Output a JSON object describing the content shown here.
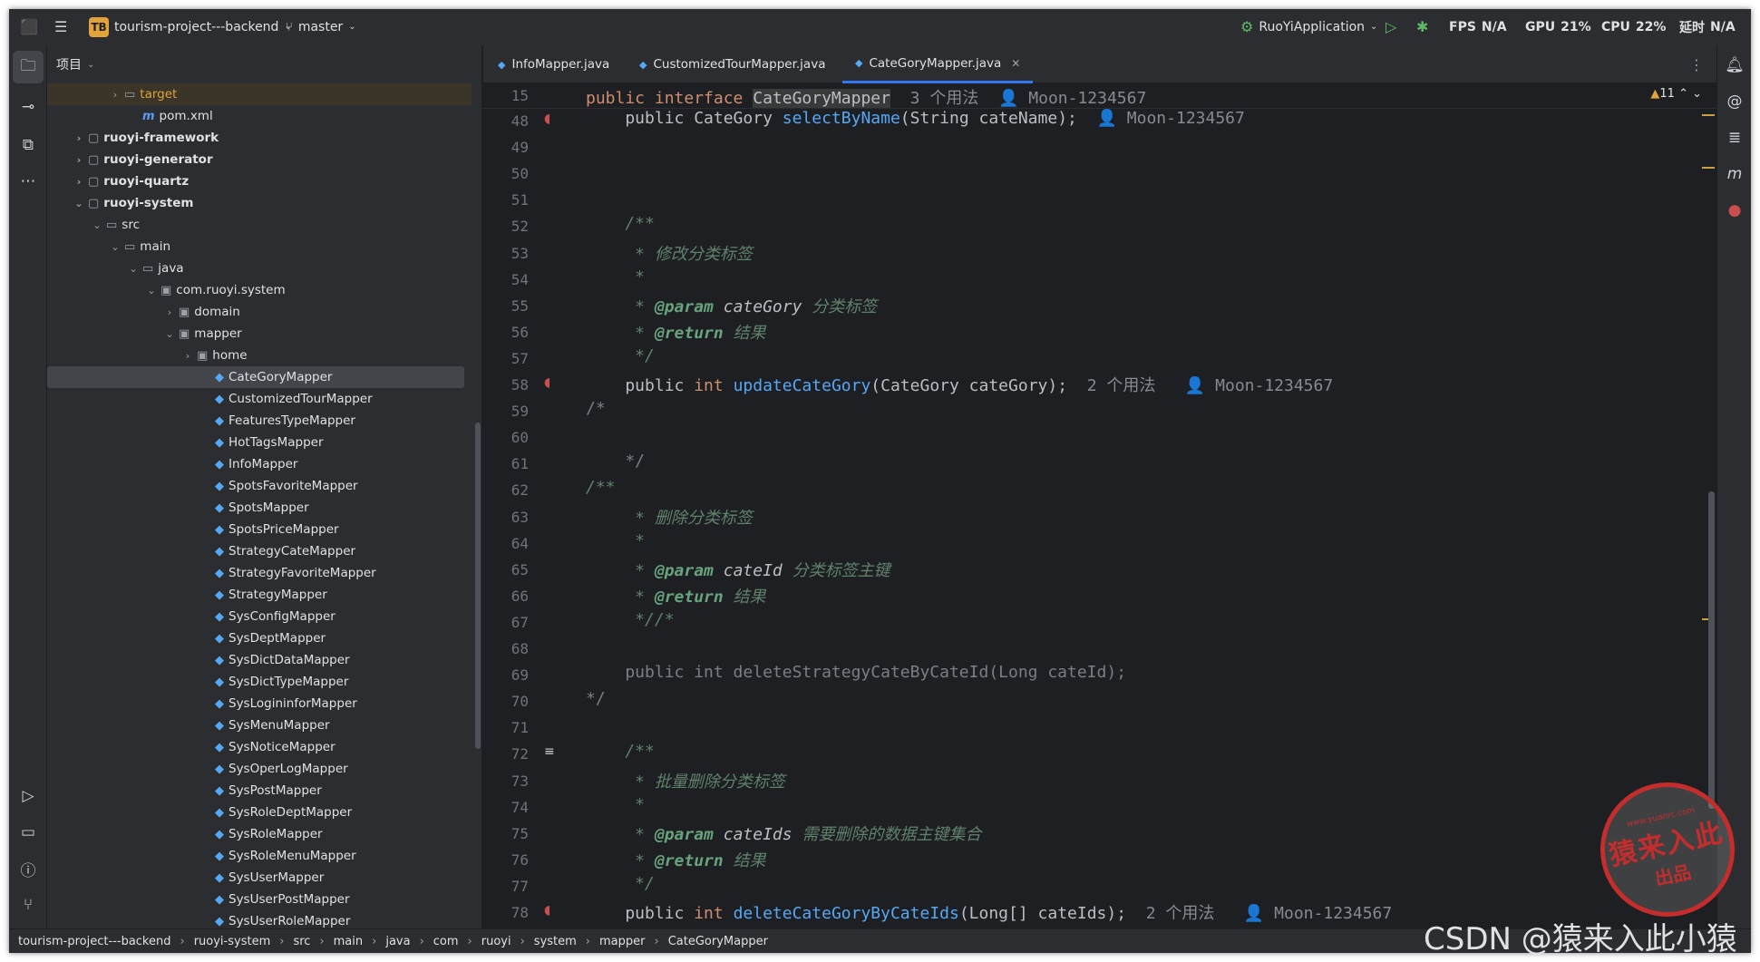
{
  "topbar": {
    "project_badge": "TB",
    "project": "tourism-project---backend",
    "branch": "master",
    "run_config": "RuoYiApplication",
    "fps_label": "FPS",
    "fps": "N/A",
    "gpu_label": "GPU",
    "gpu": "21%",
    "cpu_label": "CPU",
    "cpu": "22%",
    "time_label": "延时",
    "time": "N/A"
  },
  "project_panel": {
    "title": "项目",
    "tree": [
      {
        "label": "target",
        "depth": 3,
        "arrow": ">",
        "icon": "folder",
        "excluded": true
      },
      {
        "label": "pom.xml",
        "depth": 4,
        "arrow": "",
        "icon": "maven"
      },
      {
        "label": "ruoyi-framework",
        "depth": 1,
        "arrow": ">",
        "icon": "module",
        "bold": true
      },
      {
        "label": "ruoyi-generator",
        "depth": 1,
        "arrow": ">",
        "icon": "module",
        "bold": true
      },
      {
        "label": "ruoyi-quartz",
        "depth": 1,
        "arrow": ">",
        "icon": "module",
        "bold": true
      },
      {
        "label": "ruoyi-system",
        "depth": 1,
        "arrow": "v",
        "icon": "module",
        "bold": true
      },
      {
        "label": "src",
        "depth": 2,
        "arrow": "v",
        "icon": "folder"
      },
      {
        "label": "main",
        "depth": 3,
        "arrow": "v",
        "icon": "folder"
      },
      {
        "label": "java",
        "depth": 4,
        "arrow": "v",
        "icon": "folder"
      },
      {
        "label": "com.ruoyi.system",
        "depth": 5,
        "arrow": "v",
        "icon": "package"
      },
      {
        "label": "domain",
        "depth": 6,
        "arrow": ">",
        "icon": "package"
      },
      {
        "label": "mapper",
        "depth": 6,
        "arrow": "v",
        "icon": "package"
      },
      {
        "label": "home",
        "depth": 7,
        "arrow": ">",
        "icon": "package"
      },
      {
        "label": "CateGoryMapper",
        "depth": 8,
        "arrow": "",
        "icon": "interface",
        "selected": true
      },
      {
        "label": "CustomizedTourMapper",
        "depth": 8,
        "arrow": "",
        "icon": "interface"
      },
      {
        "label": "FeaturesTypeMapper",
        "depth": 8,
        "arrow": "",
        "icon": "interface"
      },
      {
        "label": "HotTagsMapper",
        "depth": 8,
        "arrow": "",
        "icon": "interface"
      },
      {
        "label": "InfoMapper",
        "depth": 8,
        "arrow": "",
        "icon": "interface"
      },
      {
        "label": "SpotsFavoriteMapper",
        "depth": 8,
        "arrow": "",
        "icon": "interface"
      },
      {
        "label": "SpotsMapper",
        "depth": 8,
        "arrow": "",
        "icon": "interface"
      },
      {
        "label": "SpotsPriceMapper",
        "depth": 8,
        "arrow": "",
        "icon": "interface"
      },
      {
        "label": "StrategyCateMapper",
        "depth": 8,
        "arrow": "",
        "icon": "interface"
      },
      {
        "label": "StrategyFavoriteMapper",
        "depth": 8,
        "arrow": "",
        "icon": "interface"
      },
      {
        "label": "StrategyMapper",
        "depth": 8,
        "arrow": "",
        "icon": "interface"
      },
      {
        "label": "SysConfigMapper",
        "depth": 8,
        "arrow": "",
        "icon": "interface"
      },
      {
        "label": "SysDeptMapper",
        "depth": 8,
        "arrow": "",
        "icon": "interface"
      },
      {
        "label": "SysDictDataMapper",
        "depth": 8,
        "arrow": "",
        "icon": "interface"
      },
      {
        "label": "SysDictTypeMapper",
        "depth": 8,
        "arrow": "",
        "icon": "interface"
      },
      {
        "label": "SysLogininforMapper",
        "depth": 8,
        "arrow": "",
        "icon": "interface"
      },
      {
        "label": "SysMenuMapper",
        "depth": 8,
        "arrow": "",
        "icon": "interface"
      },
      {
        "label": "SysNoticeMapper",
        "depth": 8,
        "arrow": "",
        "icon": "interface"
      },
      {
        "label": "SysOperLogMapper",
        "depth": 8,
        "arrow": "",
        "icon": "interface"
      },
      {
        "label": "SysPostMapper",
        "depth": 8,
        "arrow": "",
        "icon": "interface"
      },
      {
        "label": "SysRoleDeptMapper",
        "depth": 8,
        "arrow": "",
        "icon": "interface"
      },
      {
        "label": "SysRoleMapper",
        "depth": 8,
        "arrow": "",
        "icon": "interface"
      },
      {
        "label": "SysRoleMenuMapper",
        "depth": 8,
        "arrow": "",
        "icon": "interface"
      },
      {
        "label": "SysUserMapper",
        "depth": 8,
        "arrow": "",
        "icon": "interface"
      },
      {
        "label": "SysUserPostMapper",
        "depth": 8,
        "arrow": "",
        "icon": "interface"
      },
      {
        "label": "SysUserRoleMapper",
        "depth": 8,
        "arrow": "",
        "icon": "interface"
      }
    ]
  },
  "tabs": [
    {
      "label": "InfoMapper.java",
      "active": false
    },
    {
      "label": "CustomizedTourMapper.java",
      "active": false
    },
    {
      "label": "CateGoryMapper.java",
      "active": true
    }
  ],
  "editor": {
    "warnings": "11",
    "sticky": {
      "line": "15",
      "kw": "public interface ",
      "name": "CateGoryMapper",
      "usages": "3 个用法",
      "author": "Moon-1234567"
    },
    "lines": [
      {
        "n": "48",
        "mark": true,
        "parts": [
          [
            "",
            "    public CateGory "
          ],
          [
            "fn",
            "selectByName"
          ],
          [
            "",
            "(String cateName);  "
          ],
          [
            "ux",
            "👤 Moon-1234567"
          ]
        ]
      },
      {
        "n": "49",
        "parts": []
      },
      {
        "n": "50",
        "parts": []
      },
      {
        "n": "51",
        "parts": []
      },
      {
        "n": "52",
        "parts": [
          [
            "doc",
            "    /**"
          ]
        ]
      },
      {
        "n": "53",
        "parts": [
          [
            "doc",
            "     * 修改分类标签"
          ]
        ]
      },
      {
        "n": "54",
        "parts": [
          [
            "doc",
            "     *"
          ]
        ]
      },
      {
        "n": "55",
        "parts": [
          [
            "doc",
            "     * "
          ],
          [
            "tag",
            "@param"
          ],
          [
            "pn",
            " cateGory "
          ],
          [
            "doc",
            "分类标签"
          ]
        ]
      },
      {
        "n": "56",
        "parts": [
          [
            "doc",
            "     * "
          ],
          [
            "tag",
            "@return"
          ],
          [
            "doc",
            " 结果"
          ]
        ]
      },
      {
        "n": "57",
        "parts": [
          [
            "doc",
            "     */"
          ]
        ]
      },
      {
        "n": "58",
        "mark": true,
        "parts": [
          [
            "",
            "    public "
          ],
          [
            "kw",
            "int "
          ],
          [
            "fn",
            "updateCateGory"
          ],
          [
            "",
            "(CateGory cateGory);  "
          ],
          [
            "ux",
            "2 个用法   👤 Moon-1234567"
          ]
        ]
      },
      {
        "n": "59",
        "parts": [
          [
            "cm",
            "/*"
          ]
        ]
      },
      {
        "n": "60",
        "parts": []
      },
      {
        "n": "61",
        "parts": [
          [
            "cm",
            "    */"
          ]
        ]
      },
      {
        "n": "62",
        "parts": [
          [
            "doc",
            "/**"
          ]
        ]
      },
      {
        "n": "63",
        "parts": [
          [
            "doc",
            "     * 删除分类标签"
          ]
        ]
      },
      {
        "n": "64",
        "parts": [
          [
            "doc",
            "     *"
          ]
        ]
      },
      {
        "n": "65",
        "parts": [
          [
            "doc",
            "     * "
          ],
          [
            "tag",
            "@param"
          ],
          [
            "pn",
            " cateId "
          ],
          [
            "doc",
            "分类标签主键"
          ]
        ]
      },
      {
        "n": "66",
        "parts": [
          [
            "doc",
            "     * "
          ],
          [
            "tag",
            "@return"
          ],
          [
            "doc",
            " 结果"
          ]
        ]
      },
      {
        "n": "67",
        "parts": [
          [
            "doc",
            "     *//*"
          ]
        ]
      },
      {
        "n": "68",
        "parts": []
      },
      {
        "n": "69",
        "parts": [
          [
            "cm",
            "    public int deleteStrategyCateByCateId(Long cateId);"
          ]
        ]
      },
      {
        "n": "70",
        "parts": [
          [
            "cm",
            "*/"
          ]
        ]
      },
      {
        "n": "71",
        "parts": []
      },
      {
        "n": "72",
        "doc": true,
        "parts": [
          [
            "doc",
            "    /**"
          ]
        ]
      },
      {
        "n": "73",
        "parts": [
          [
            "doc",
            "     * 批量删除分类标签"
          ]
        ]
      },
      {
        "n": "74",
        "parts": [
          [
            "doc",
            "     *"
          ]
        ]
      },
      {
        "n": "75",
        "parts": [
          [
            "doc",
            "     * "
          ],
          [
            "tag",
            "@param"
          ],
          [
            "pn",
            " cateIds "
          ],
          [
            "doc",
            "需要删除的数据主键集合"
          ]
        ]
      },
      {
        "n": "76",
        "parts": [
          [
            "doc",
            "     * "
          ],
          [
            "tag",
            "@return"
          ],
          [
            "doc",
            " 结果"
          ]
        ]
      },
      {
        "n": "77",
        "parts": [
          [
            "doc",
            "     */"
          ]
        ]
      },
      {
        "n": "78",
        "mark": true,
        "parts": [
          [
            "",
            "    public "
          ],
          [
            "kw",
            "int "
          ],
          [
            "fn",
            "deleteCateGoryByCateIds"
          ],
          [
            "",
            "(Long[] cateIds);  "
          ],
          [
            "ux",
            "2 个用法   👤 Moon-1234567"
          ]
        ]
      }
    ]
  },
  "statusbar": {
    "crumbs": [
      "tourism-project---backend",
      "ruoyi-system",
      "src",
      "main",
      "java",
      "com",
      "ruoyi",
      "system",
      "mapper",
      "CateGoryMapper"
    ]
  },
  "stamp": {
    "line1": "猿来入此",
    "line2": "出品",
    "url": "www.yuanrc.com"
  },
  "watermark": "CSDN @猿来入此小猿"
}
